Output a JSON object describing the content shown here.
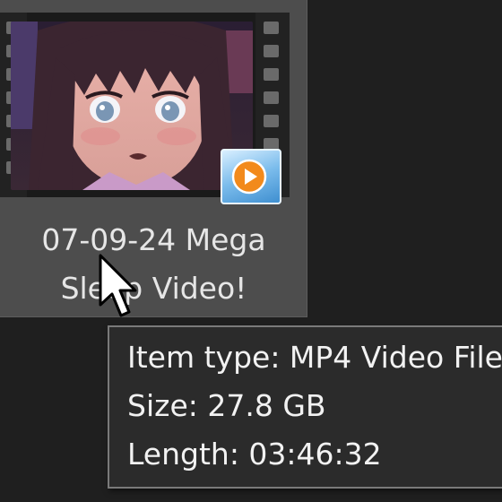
{
  "file_item": {
    "name_line1": "07-09-24 Mega",
    "name_line2": "Sleep Video!",
    "thumbnail": "video-frame-anime-character",
    "overlay_icon": "media-player-icon"
  },
  "tooltip": {
    "item_type": "Item type: MP4 Video File",
    "size": "Size: 27.8 GB",
    "length": "Length: 03:46:32"
  },
  "cursor": "arrow-cursor-icon",
  "colors": {
    "background": "#1f1f1f",
    "tile_highlight": "#4d4d4d",
    "tooltip_bg": "#2b2b2b",
    "tooltip_border": "#7a7a7a",
    "text": "#e6e6e6",
    "badge_orange": "#f28a1c"
  }
}
